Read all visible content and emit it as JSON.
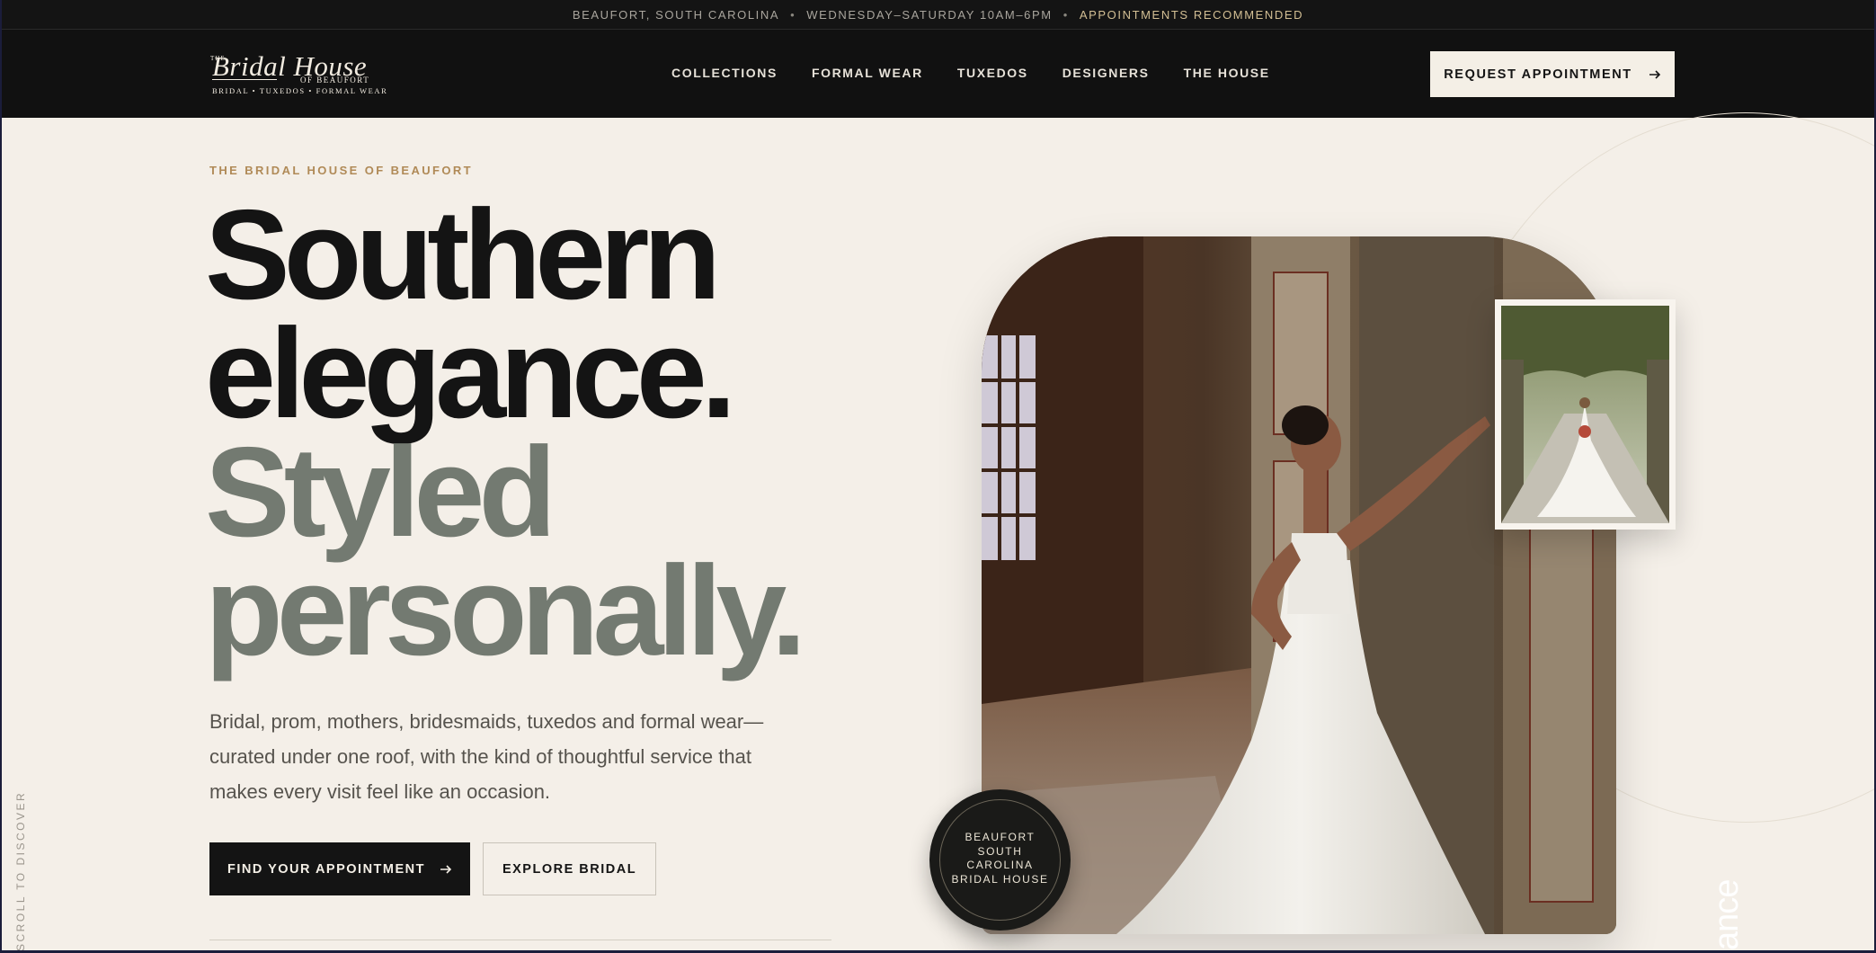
{
  "topbar": {
    "location": "BEAUFORT, SOUTH CAROLINA",
    "hours": "WEDNESDAY–SATURDAY 10AM–6PM",
    "note": "APPOINTMENTS RECOMMENDED",
    "separator": "•"
  },
  "logo": {
    "the": "THE",
    "script": "Bridal House",
    "of": "OF BEAUFORT",
    "sub": "BRIDAL • TUXEDOS • FORMAL WEAR"
  },
  "nav": {
    "items": [
      "COLLECTIONS",
      "FORMAL WEAR",
      "TUXEDOS",
      "DESIGNERS",
      "THE HOUSE"
    ]
  },
  "header_cta": {
    "label": "REQUEST APPOINTMENT",
    "icon": "arrow-right-icon"
  },
  "hero": {
    "eyebrow": "THE BRIDAL HOUSE OF BEAUFORT",
    "headline": [
      "Southern",
      "elegance.",
      "Styled",
      "personally."
    ],
    "lede": "Bridal, prom, mothers, bridesmaids, tuxedos and formal wear—curated under one roof, with the kind of thoughtful service that makes every visit feel like an occasion.",
    "primary_cta": "FIND YOUR APPOINTMENT",
    "secondary_cta": "EXPLORE BRIDAL",
    "scroll_hint": "SCROLL TO DISCOVER",
    "badge": [
      "BEAUFORT",
      "SOUTH",
      "CAROLINA",
      "BRIDAL HOUSE"
    ],
    "vertical_word": "ance"
  },
  "images": {
    "main": "bride-in-historic-mansion",
    "thumb": "bride-on-oak-lined-road"
  },
  "colors": {
    "background": "#f4efe8",
    "header": "#111111",
    "accent_gold": "#b08a57",
    "headline_dark": "#141414",
    "headline_sage": "#737a71"
  }
}
